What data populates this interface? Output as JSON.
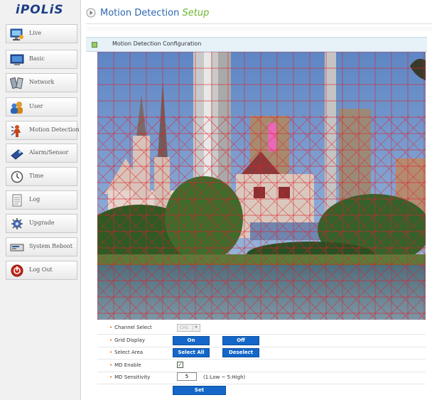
{
  "logo": "iPOLiS",
  "sidebar": {
    "items": [
      {
        "label": "Live",
        "icon": "live-icon"
      },
      {
        "label": "Basic",
        "icon": "monitor-icon"
      },
      {
        "label": "Network",
        "icon": "network-icon"
      },
      {
        "label": "User",
        "icon": "user-icon"
      },
      {
        "label": "Motion Detection",
        "icon": "motion-detection-icon"
      },
      {
        "label": "Alarm/Sensor",
        "icon": "alarm-sensor-icon"
      },
      {
        "label": "Time",
        "icon": "clock-icon"
      },
      {
        "label": "Log",
        "icon": "log-icon"
      },
      {
        "label": "Upgrade",
        "icon": "upgrade-icon"
      },
      {
        "label": "System Reboot",
        "icon": "reboot-icon"
      },
      {
        "label": "Log Out",
        "icon": "logout-icon"
      }
    ]
  },
  "header": {
    "title": "Motion Detection",
    "title_suffix": "Setup"
  },
  "section": {
    "title": "Motion Detection Configuration"
  },
  "form": {
    "channel_select": {
      "label": "Channel Select",
      "value": "CH1"
    },
    "grid_display": {
      "label": "Grid Display",
      "on": "On",
      "off": "Off"
    },
    "select_area": {
      "label": "Select Area",
      "select_all": "Select All",
      "deselect": "Deselect"
    },
    "md_enable": {
      "label": "MD Enable",
      "checked": true
    },
    "md_sensitivity": {
      "label": "MD Sensitivity",
      "value": "5",
      "hint": "(1:Low ~ 5:High)"
    },
    "set_button": "Set"
  },
  "colors": {
    "accent_blue": "#1467c9",
    "title_blue": "#2f67b0",
    "setup_green": "#6ab62c",
    "grid_red": "#e0202a"
  }
}
